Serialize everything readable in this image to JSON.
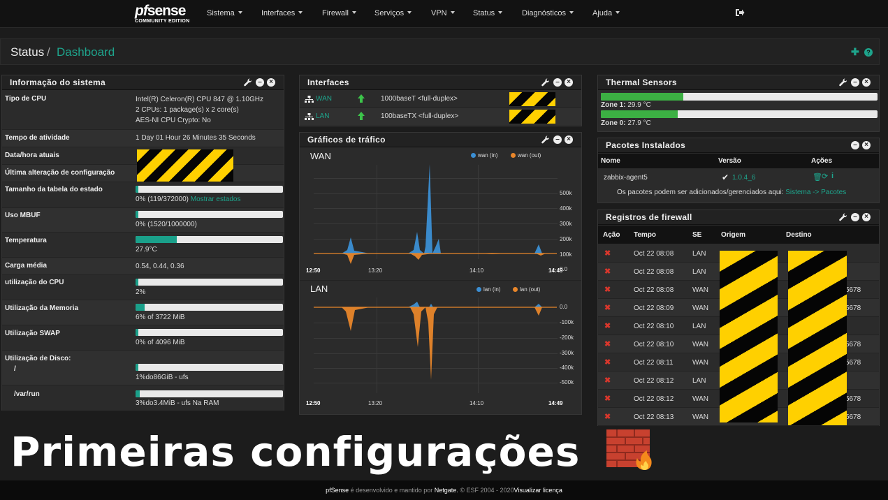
{
  "nav": {
    "logo_text": "pfsense",
    "logo_pf": "pf",
    "logo_sense": "sense",
    "logo_edition": "COMMUNITY EDITION",
    "items": [
      "Sistema",
      "Interfaces",
      "Firewall",
      "Serviços",
      "VPN",
      "Status",
      "Diagnósticos",
      "Ajuda"
    ]
  },
  "title": {
    "section": "Status",
    "separator": "/",
    "page": "Dashboard"
  },
  "sysinfo": {
    "title": "Informação do sistema",
    "cpu_type_label": "Tipo de CPU",
    "cpu_type_lines": [
      "Intel(R) Celeron(R) CPU 847 @ 1.10GHz",
      "2 CPUs: 1 package(s) x 2 core(s)",
      "AES-NI CPU Crypto: No"
    ],
    "uptime_label": "Tempo de atividade",
    "uptime": "1 Day 01 Hour 26 Minutes 35 Seconds",
    "datetime_label": "Data/hora atuais",
    "lastconfig_label": "Última alteração de configuração",
    "state_label": "Tamanho da tabela do estado",
    "state_value": "0% (119/372000)",
    "state_link": "Mostrar estados",
    "state_fill": 0.0,
    "mbuf_label": "Uso MBUF",
    "mbuf_value": "0% (1520/1000000)",
    "mbuf_fill": 0.0,
    "temp_label": "Temperatura",
    "temp_value": "27.9°C",
    "temp_fill": 0.279,
    "load_label": "Carga média",
    "load_value": "0.54, 0.44, 0.36",
    "cpu_label": "utilização do CPU",
    "cpu_value": "2%",
    "cpu_fill": 0.02,
    "mem_label": "Utilização da Memoria",
    "mem_value": "6% of 3722 MiB",
    "mem_fill": 0.06,
    "swap_label": "Utilização SWAP",
    "swap_value": "0% of 4096 MiB",
    "swap_fill": 0.0,
    "disk_label": "Utilização de Disco:",
    "disk1_mount": "/",
    "disk1_value": "1%do86GiB - ufs",
    "disk1_fill": 0.01,
    "disk2_mount": "/var/run",
    "disk2_value": "3%do3.4MiB - ufs Na RAM",
    "disk2_fill": 0.03
  },
  "interfaces": {
    "title": "Interfaces",
    "rows": [
      {
        "name": "WAN",
        "speed": "1000baseT <full-duplex>"
      },
      {
        "name": "LAN",
        "speed": "100baseTX <full-duplex>"
      }
    ]
  },
  "traffic": {
    "title": "Gráficos de tráfico",
    "wan": {
      "name": "WAN",
      "legend_in": "wan (in)",
      "legend_out": "wan (out)",
      "yticks": [
        "500k",
        "400k",
        "300k",
        "200k",
        "100k",
        "0.0"
      ],
      "xticks": [
        "12:50",
        "13:20",
        "14:10",
        "14:49"
      ]
    },
    "lan": {
      "name": "LAN",
      "legend_in": "lan (in)",
      "legend_out": "lan (out)",
      "yticks": [
        "0.0",
        "-100k",
        "-200k",
        "-300k",
        "-400k",
        "-500k"
      ],
      "xticks": [
        "12:50",
        "13:20",
        "14:10",
        "14:49"
      ]
    },
    "colors": {
      "in": "#3b8fd4",
      "out": "#e8862a"
    }
  },
  "chart_data": [
    {
      "type": "area",
      "title": "WAN",
      "series": [
        {
          "name": "wan (in)",
          "x": [
            "12:50",
            "13:00",
            "13:14",
            "13:30",
            "13:44",
            "13:50",
            "13:53",
            "14:00",
            "14:14",
            "14:40",
            "14:49"
          ],
          "values": [
            0,
            15000,
            95000,
            0,
            120000,
            0,
            480000,
            60000,
            0,
            40000,
            0
          ]
        },
        {
          "name": "wan (out)",
          "values": [
            0,
            -5000,
            -40000,
            0,
            -10000,
            0,
            -20000,
            -8000,
            0,
            -5000,
            0
          ]
        }
      ],
      "ylim": [
        -50000,
        550000
      ]
    },
    {
      "type": "area",
      "title": "LAN",
      "series": [
        {
          "name": "lan (in)",
          "values": [
            0,
            0,
            5000,
            0,
            10000,
            15000,
            0,
            0,
            0,
            5000,
            0
          ]
        },
        {
          "name": "lan (out)",
          "x": [
            "12:50",
            "13:00",
            "13:14",
            "13:30",
            "13:44",
            "13:50",
            "13:53",
            "14:00",
            "14:14",
            "14:40",
            "14:49"
          ],
          "values": [
            0,
            -20000,
            -90000,
            0,
            -240000,
            -100000,
            -490000,
            -30000,
            0,
            -40000,
            0
          ]
        }
      ],
      "ylim": [
        -550000,
        20000
      ]
    }
  ],
  "thermal": {
    "title": "Thermal Sensors",
    "zones": [
      {
        "label": "Zone 1:",
        "value": "29.9 °C",
        "fill": 0.299
      },
      {
        "label": "Zone 0:",
        "value": "27.9 °C",
        "fill": 0.279
      }
    ]
  },
  "packages": {
    "title": "Pacotes Instalados",
    "col_name": "Nome",
    "col_version": "Versão",
    "col_actions": "Ações",
    "rows": [
      {
        "name": "zabbix-agent5",
        "version": "1.0.4_6"
      }
    ],
    "note": "Os pacotes podem ser adicionados/gerenciados aqui:",
    "note_link": "Sistema -> Pacotes"
  },
  "firewall": {
    "title": "Registros de firewall",
    "col_action": "Ação",
    "col_time": "Tempo",
    "col_if": "SE",
    "col_src": "Origem",
    "col_dst": "Destino",
    "rows": [
      {
        "time": "Oct 22 08:08",
        "if": "LAN",
        "dst_tail": ""
      },
      {
        "time": "Oct 22 08:08",
        "if": "LAN",
        "dst_tail": ""
      },
      {
        "time": "Oct 22 08:08",
        "if": "WAN",
        "dst_tail": "5678"
      },
      {
        "time": "Oct 22 08:09",
        "if": "WAN",
        "dst_tail": "5678"
      },
      {
        "time": "Oct 22 08:10",
        "if": "LAN",
        "dst_tail": ""
      },
      {
        "time": "Oct 22 08:10",
        "if": "WAN",
        "dst_tail": "5678"
      },
      {
        "time": "Oct 22 08:11",
        "if": "WAN",
        "dst_tail": "5678"
      },
      {
        "time": "Oct 22 08:12",
        "if": "LAN",
        "dst_tail": ""
      },
      {
        "time": "Oct 22 08:12",
        "if": "WAN",
        "dst_tail": "5678"
      },
      {
        "time": "Oct 22 08:13",
        "if": "WAN",
        "dst_tail": "5678"
      }
    ]
  },
  "overlay_text": "Primeiras configurações",
  "footer": {
    "brand": "pfSense",
    "text1": "é desenvolvido e mantido por",
    "company": "Netgate.",
    "text2": "© ESF 2004 - 2020",
    "license": "Visualizar licença"
  }
}
